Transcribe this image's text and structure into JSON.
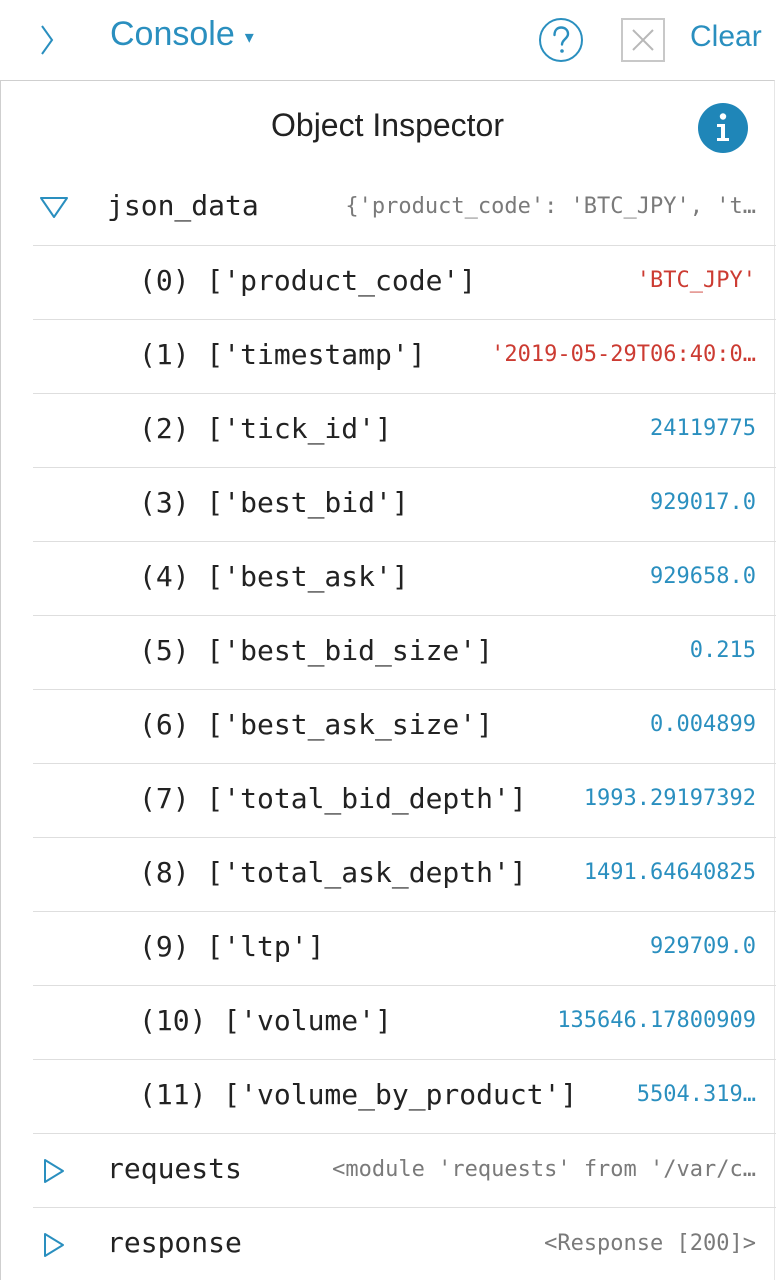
{
  "toolbar": {
    "title": "Console",
    "caret": "▾",
    "clear_label": "Clear",
    "accent_color": "#2a8fbf"
  },
  "inspector": {
    "title": "Object Inspector"
  },
  "variables": [
    {
      "name": "json_data",
      "preview": "{'product_code': 'BTC_JPY', 't…",
      "expanded": true
    },
    {
      "name": "requests",
      "preview": "<module 'requests' from '/var/c…",
      "expanded": false
    },
    {
      "name": "response",
      "preview": "<Response [200]>",
      "expanded": false
    }
  ],
  "items": [
    {
      "key": "(0) ['product_code']",
      "value": "'BTC_JPY'",
      "kind": "string"
    },
    {
      "key": "(1) ['timestamp']",
      "value": "'2019-05-29T06:40:0…",
      "kind": "string"
    },
    {
      "key": "(2) ['tick_id']",
      "value": "24119775",
      "kind": "number"
    },
    {
      "key": "(3) ['best_bid']",
      "value": "929017.0",
      "kind": "number"
    },
    {
      "key": "(4) ['best_ask']",
      "value": "929658.0",
      "kind": "number"
    },
    {
      "key": "(5) ['best_bid_size']",
      "value": "0.215",
      "kind": "number"
    },
    {
      "key": "(6) ['best_ask_size']",
      "value": "0.004899",
      "kind": "number"
    },
    {
      "key": "(7) ['total_bid_depth']",
      "value": "1993.29197392",
      "kind": "number"
    },
    {
      "key": "(8) ['total_ask_depth']",
      "value": "1491.64640825",
      "kind": "number"
    },
    {
      "key": "(9) ['ltp']",
      "value": "929709.0",
      "kind": "number"
    },
    {
      "key": "(10) ['volume']",
      "value": "135646.17800909",
      "kind": "number"
    },
    {
      "key": "(11) ['volume_by_product']",
      "value": "5504.319…",
      "kind": "number"
    }
  ]
}
